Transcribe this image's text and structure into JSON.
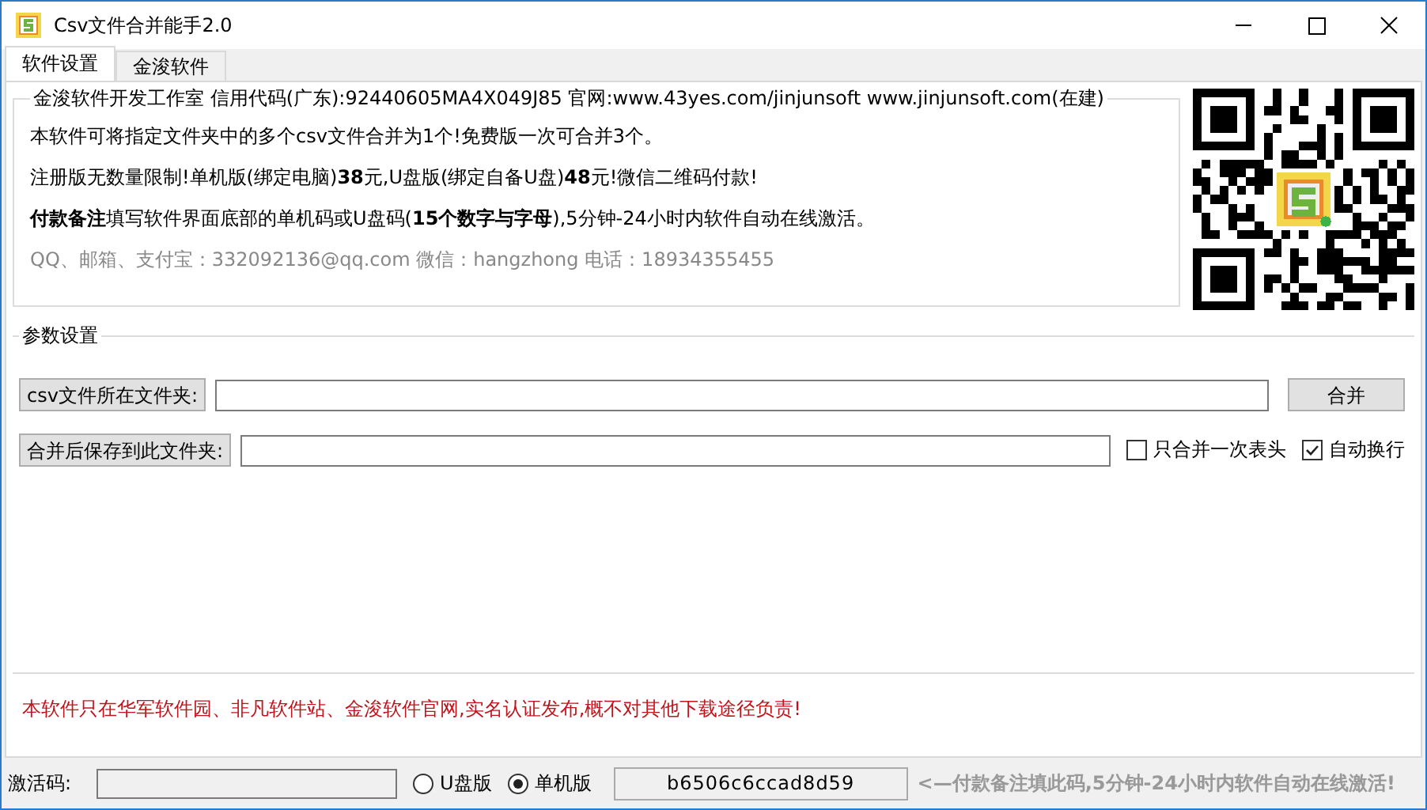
{
  "window": {
    "title": "Csv文件合并能手2.0"
  },
  "tabs": [
    {
      "label": "软件设置",
      "selected": true
    },
    {
      "label": "金浚软件",
      "selected": false
    }
  ],
  "info": {
    "legend": "金浚软件开发工作室 信用代码(广东):92440605MA4X049J85 官网:www.43yes.com/jinjunsoft  www.jinjunsoft.com(在建)",
    "lines": [
      "本软件可将指定文件夹中的多个csv文件合并为1个!免费版一次可合并3个。",
      "注册版无数量限制!单机版(绑定电脑)**38**元,U盘版(绑定自备U盘)**48**元!微信二维码付款!",
      "**付款备注**填写软件界面底部的单机码或U盘码(**15个数字与字母**),5分钟-24小时内软件自动在线激活。"
    ],
    "contact": "QQ、邮箱、支付宝：332092136@qq.com   微信：hangzhong   电话：18934355455"
  },
  "params": {
    "legend": "参数设置",
    "source_button": "csv文件所在文件夹:",
    "merge_button": "合并",
    "target_button": "合并后保存到此文件夹:",
    "checkboxes": [
      {
        "label": "只合并一次表头",
        "checked": false
      },
      {
        "label": "自动换行",
        "checked": true
      }
    ]
  },
  "notice": "本软件只在华军软件园、非凡软件站、金浚软件官网,实名认证发布,概不对其他下载途径负责!",
  "footer": {
    "label": "激活码:",
    "radios": [
      {
        "label": "U盘版",
        "selected": false
      },
      {
        "label": "单机版",
        "selected": true
      }
    ],
    "machine_code": "b6506c6ccad8d59",
    "hint": "<—付款备注填此码,5分钟-24小时内软件自动在线激活!"
  }
}
